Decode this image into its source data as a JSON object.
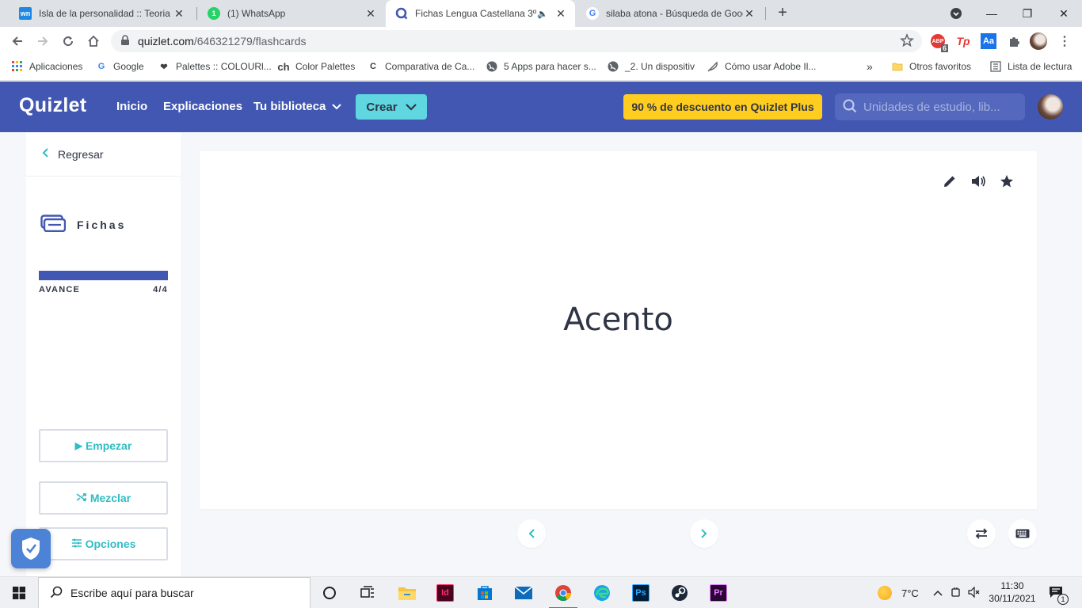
{
  "browser": {
    "tabs": [
      {
        "title": "Isla de la personalidad :: Teoria TI",
        "favicon": "wn",
        "active": false
      },
      {
        "title": "(1) WhatsApp",
        "favicon": "1",
        "active": false
      },
      {
        "title": "Fichas Lengua Castellana 3º ...",
        "favicon": "quizlet",
        "active": true
      },
      {
        "title": "silaba atona - Búsqueda de Google",
        "favicon": "G",
        "active": false
      }
    ],
    "address": {
      "host": "quizlet.com",
      "path": "/646321279/flashcards"
    },
    "extensions": {
      "abp_count": "6",
      "tp": "Tp",
      "aa": "Aa"
    },
    "bookmarks": [
      {
        "label": "Aplicaciones",
        "icon": "apps-grid-icon"
      },
      {
        "label": "Google",
        "icon": "G"
      },
      {
        "label": "Palettes :: COLOURl...",
        "icon": "heart-icon"
      },
      {
        "label": "Color Palettes",
        "icon": "ch"
      },
      {
        "label": "Comparativa de Ca...",
        "icon": "C"
      },
      {
        "label": "5 Apps para hacer s...",
        "icon": "globe-icon"
      },
      {
        "label": "_2. Un dispositiv",
        "icon": "globe-icon"
      },
      {
        "label": "Cómo usar Adobe Il...",
        "icon": "feather-icon"
      }
    ],
    "bookmarks_overflow": "»",
    "other_favorites": "Otros favoritos",
    "reading_list": "Lista de lectura"
  },
  "quizlet": {
    "logo": "Quizlet",
    "nav": {
      "home": "Inicio",
      "explanations": "Explicaciones",
      "library": "Tu biblioteca"
    },
    "create": "Crear",
    "promo": "90 % de descuento en Quizlet Plus",
    "search_placeholder": "Unidades de estudio, lib...",
    "sidebar": {
      "back": "Regresar",
      "mode": "Fichas",
      "progress_label": "AVANCE",
      "progress_text": "4/4",
      "progress_fraction": 1.0,
      "start": "Empezar",
      "shuffle": "Mezclar",
      "options": "Opciones"
    },
    "card": {
      "term": "Acento"
    },
    "colors": {
      "brand": "#4257b2",
      "accent": "#2fbdc4",
      "promo": "#ffcd1f"
    }
  },
  "taskbar": {
    "search_placeholder": "Escribe aquí para buscar",
    "weather": "7°C",
    "time": "11:30",
    "date": "30/11/2021",
    "notifications": "1"
  }
}
